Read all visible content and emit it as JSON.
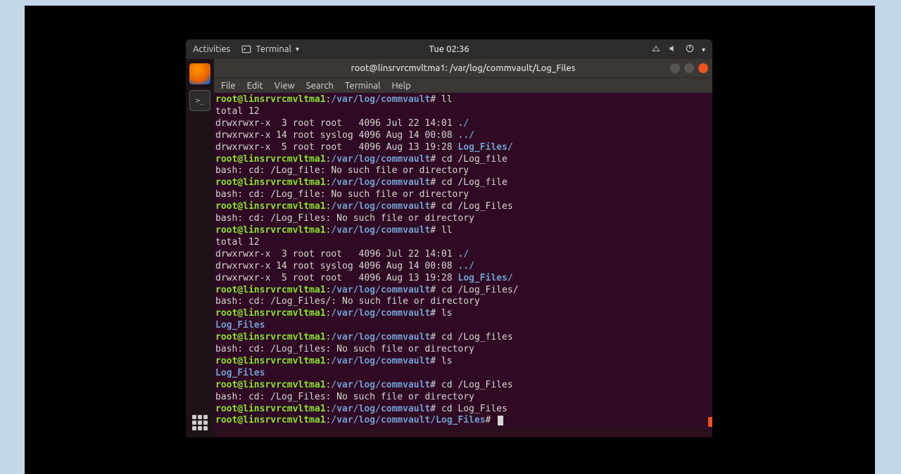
{
  "topbar": {
    "activities": "Activities",
    "app_label": "Terminal",
    "clock": "Tue 02:36"
  },
  "titlebar": {
    "title": "root@linsrvrcmvltma1: /var/log/commvault/Log_Files"
  },
  "menubar": {
    "file": "File",
    "edit": "Edit",
    "view": "View",
    "search": "Search",
    "terminal": "Terminal",
    "help": "Help"
  },
  "prompt": {
    "user": "root@linsrvrcmvltma1",
    "sep": ":",
    "path1": "/var/log/commvault",
    "path2": "/var/log/commvault/Log_Files",
    "hash": "#"
  },
  "output": {
    "total12": "total 12",
    "ls_line1": "drwxrwxr-x  3 root root   4096 Jul 22 14:01 ",
    "ls_line1_dir": "./",
    "ls_line2": "drwxrwxr-x 14 root syslog 4096 Aug 14 00:08 ",
    "ls_line2_dir": "../",
    "ls_line3": "drwxrwxr-x  5 root root   4096 Aug 13 19:28 ",
    "ls_line3_dir": "Log_Files/",
    "err_logfile": "bash: cd: /Log_file: No such file or directory",
    "err_logfiles": "bash: cd: /Log_Files: No such file or directory",
    "err_logfiles_slash": "bash: cd: /Log_Files/: No such file or directory",
    "err_log_lower": "bash: cd: /Log_files: No such file or directory",
    "logfiles_dir": "Log_Files"
  },
  "cmds": {
    "ll": " ll",
    "cd_logfile": " cd /Log_file",
    "cd_logfiles": " cd /Log_Files",
    "cd_logfiles_slash": " cd /Log_Files/",
    "ls": " ls",
    "cd_log_lower": " cd /Log_files",
    "cd_final": " cd Log_Files"
  }
}
